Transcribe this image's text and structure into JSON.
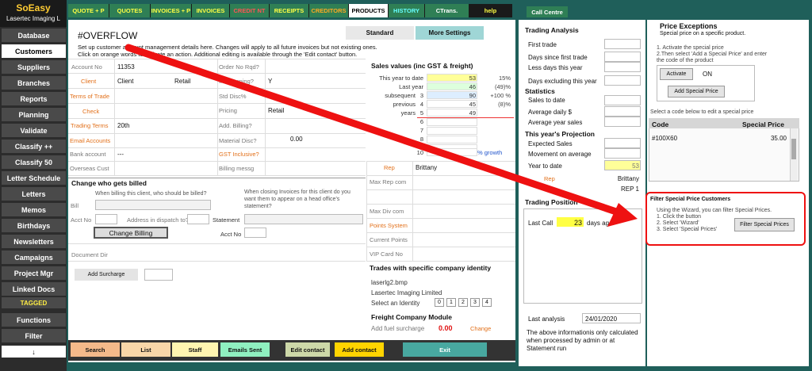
{
  "brand": {
    "title": "SoEasy",
    "subtitle": "Lasertec Imaging L"
  },
  "sidebar": {
    "items": [
      "Database",
      "Customers",
      "Suppliers",
      "Branches",
      "Reports",
      "Planning",
      "Validate",
      "Classify ++",
      "Classify 50",
      "Letter Schedule",
      "Letters",
      "Memos",
      "Birthdays",
      "Newsletters",
      "Campaigns",
      "Project Mgr",
      "Linked Docs",
      "TAGGED",
      "Functions",
      "Filter",
      "↓"
    ]
  },
  "topnav": {
    "tabs": [
      "QUOTE + P",
      "QUOTES",
      "INVOICES + P",
      "INVOICES",
      "CREDIT NT",
      "RECEIPTS",
      "CREDITORS",
      "PRODUCTS",
      "HISTORY",
      "CTrans.",
      "help"
    ],
    "call_centre": "Call Centre"
  },
  "header": {
    "title": "#OVERFLOW",
    "tab_standard": "Standard",
    "tab_more": "More Settings",
    "info1": "Set up customer account management details here. Changes will apply to all future invoices but not existing ones.",
    "info2": "Click on orange words to activate an action. Additional editing is available through the 'Edit contact' button."
  },
  "account": {
    "account_no_label": "Account No",
    "account_no": "11353",
    "client_label": "Client",
    "client": "Client",
    "client_type": "Retail",
    "terms_label": "Terms of Trade",
    "check_label": "Check",
    "trading_terms_label": "Trading Terms",
    "trading_terms": "20th",
    "email_label": "Email Accounts",
    "bank_label": "Bank account",
    "bank": "---",
    "overseas_label": "Overseas Cust",
    "order_no_label": "Order No Rqd?",
    "inv_warning_label": "Inv Warning?",
    "inv_warning": "Y",
    "std_disc_label": "Std Disc%",
    "pricing_label": "Pricing",
    "pricing": "Retail",
    "add_billing_label": "Add. Billing?",
    "material_label": "Material Disc?",
    "material": "0.00",
    "gst_label": "GST Inclusive?",
    "billing_msg_label": "Billing messg"
  },
  "sales": {
    "title": "Sales values (inc GST & freight)",
    "rows": [
      {
        "label": "This year to date",
        "num": "",
        "value": "53",
        "pct": "15%"
      },
      {
        "label": "Last year",
        "num": "",
        "value": "46",
        "pct": "(49)%"
      },
      {
        "label": "subsequent",
        "num": "3",
        "value": "90",
        "pct": "+100 %"
      },
      {
        "label": "previous",
        "num": "4",
        "value": "45",
        "pct": "(8)%"
      },
      {
        "label": "years",
        "num": "5",
        "value": "49",
        "pct": ""
      },
      {
        "label": "",
        "num": "6",
        "value": "",
        "pct": ""
      },
      {
        "label": "",
        "num": "7",
        "value": "",
        "pct": ""
      },
      {
        "label": "",
        "num": "8",
        "value": "",
        "pct": ""
      },
      {
        "label": "",
        "num": "9",
        "value": "",
        "pct": ""
      },
      {
        "label": "",
        "num": "10",
        "value": "",
        "pct": "% growth"
      }
    ],
    "rep_label": "Rep",
    "rep": "Brittany",
    "max_rep_label": "Max Rep com",
    "max_div_label": "Max Div com",
    "points_label": "Points System",
    "current_points_label": "Current Points",
    "vip_label": "VIP Card No"
  },
  "billing": {
    "title": "Change who gets billed",
    "question1": "When billing this client, who should be billed?",
    "bill_label": "Bill",
    "acct_label": "Acct No",
    "dispatch_label": "Address in dispatch to?",
    "question2": "When closing Invoices for this client do you want them to appear on a head office's statement?",
    "statement_label": "Statement",
    "acct2_label": "Acct No",
    "change_button": "Change Billing",
    "document_dir": "Document Dir",
    "add_surcharge": "Add Surcharge"
  },
  "identity": {
    "title": "Trades with specific company identity",
    "bmp": "laserlg2.bmp",
    "company": "Lasertec Imaging Limited",
    "select_label": "Select an Identity",
    "ids": [
      "0",
      "1",
      "2",
      "3",
      "4"
    ]
  },
  "freight": {
    "title": "Freight Company Module",
    "label": "Add fuel surcharge",
    "value": "0.00",
    "change": "Change"
  },
  "bottom": {
    "search": "Search",
    "list": "List",
    "staff": "Staff",
    "emails": "Emails Sent",
    "edit": "Edit contact",
    "add": "Add contact",
    "exit": "Exit"
  },
  "trading": {
    "title": "Trading Analysis",
    "first_trade": "First trade",
    "days_since": "Days since first trade",
    "less_days": "Less days this year",
    "days_excl": "Days excluding this year",
    "stats_title": "Statistics",
    "sales_to_date": "Sales to date",
    "avg_daily": "Average daily $",
    "avg_year": "Average year sales",
    "proj_title": "This year's Projection",
    "expected": "Expected Sales",
    "movement": "Movement on average",
    "ytd_label": "Year to date",
    "ytd": "53",
    "rep_label": "Rep",
    "rep": "Brittany",
    "rep_code": "REP 1",
    "position_title": "Trading Position",
    "last_call_label": "Last Call",
    "last_call": "23",
    "days_ago": "days ago.",
    "last_analysis_label": "Last analysis",
    "last_analysis": "24/01/2020",
    "note": "The above informationis only calculated when processed by admin or at Statement run"
  },
  "price": {
    "title": "Price Exceptions",
    "subtitle": "Special price on a specific product.",
    "step1": "1. Activate the special price",
    "step2": "2.Then select 'Add a Special Price' and enter the code of the product",
    "activate": "Activate",
    "on": "ON",
    "add_special": "Add Special Price",
    "select_code": "Select a code below to edit a special price",
    "col_code": "Code",
    "col_price": "Special Price",
    "rows": [
      {
        "code": "#100X60",
        "price": "35.00"
      }
    ],
    "filter_title": "Filter Special Price Customers",
    "filter_intro": "Using the Wizard, you can filter Special Prices.",
    "filter_s1": "1. Click the button",
    "filter_s2": "2. Select 'Wizard'",
    "filter_s3": "3. Select 'Special Prices'",
    "filter_button": "Filter Special Prices"
  },
  "colors": {
    "accent_green": "#2f7f55",
    "highlight_yellow": "#ffff99",
    "arrow_red": "#ee1111"
  }
}
